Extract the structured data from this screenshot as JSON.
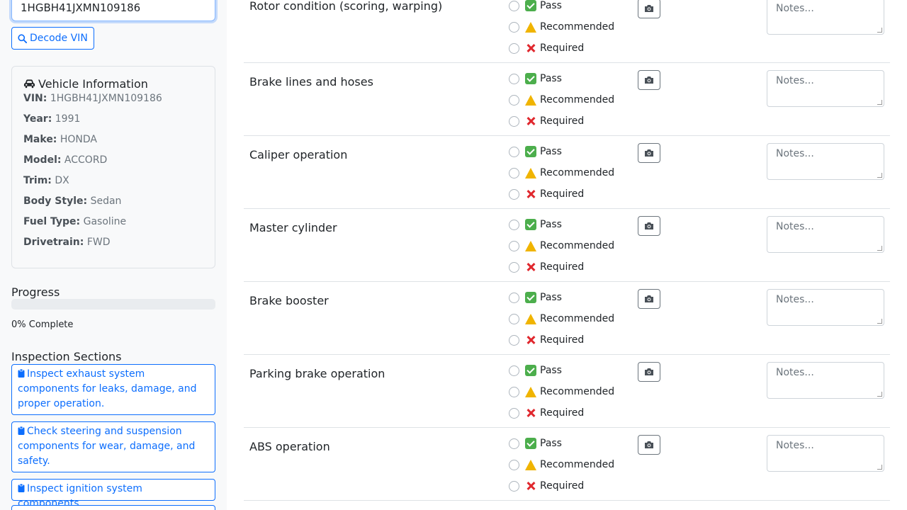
{
  "vin_input": {
    "value": "1HGBH41JXMN109186"
  },
  "decode_button": {
    "label": "Decode VIN"
  },
  "vehicle_info": {
    "title": "Vehicle Information",
    "rows": [
      {
        "label": "VIN:",
        "value": "1HGBH41JXMN109186"
      },
      {
        "label": "Year:",
        "value": "1991"
      },
      {
        "label": "Make:",
        "value": "HONDA"
      },
      {
        "label": "Model:",
        "value": "ACCORD"
      },
      {
        "label": "Trim:",
        "value": "DX"
      },
      {
        "label": "Body Style:",
        "value": "Sedan"
      },
      {
        "label": "Fuel Type:",
        "value": "Gasoline"
      },
      {
        "label": "Drivetrain:",
        "value": "FWD"
      }
    ]
  },
  "progress": {
    "label": "Progress",
    "value": 0,
    "text": "0% Complete"
  },
  "sections": {
    "label": "Inspection Sections",
    "items": [
      "Inspect exhaust system components for leaks, damage, and proper operation.",
      "Check steering and suspension components for wear, damage, and safety.",
      "Inspect ignition system components."
    ]
  },
  "options": {
    "pass": "Pass",
    "recommended": "Recommended",
    "required": "Required"
  },
  "notes_placeholder": "Notes...",
  "items": [
    "Rotor condition (scoring, warping)",
    "Brake lines and hoses",
    "Caliper operation",
    "Master cylinder",
    "Brake booster",
    "Parking brake operation",
    "ABS operation"
  ],
  "colors": {
    "primary": "#0d6efd",
    "pass": "#4cae4c",
    "warning": "#f0b400",
    "required": "#e0282e"
  },
  "icons": {
    "decode": "search-icon",
    "vehicle": "car-icon",
    "section": "clipboard-icon",
    "photo": "camera-icon"
  }
}
